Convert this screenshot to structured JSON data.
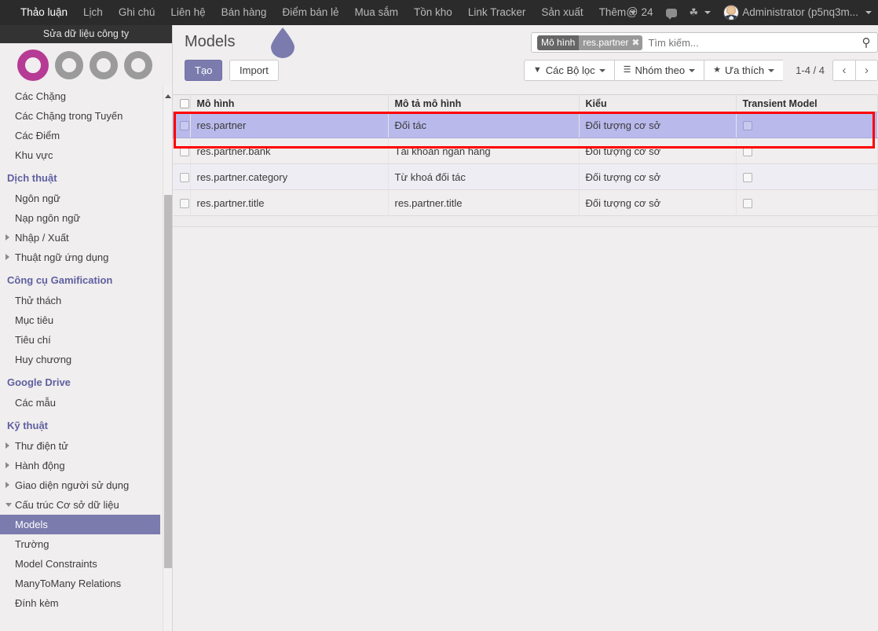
{
  "topbar": {
    "menu_items": [
      {
        "label": "Thảo luận",
        "name": "nav-discuss"
      },
      {
        "label": "Lịch",
        "name": "nav-calendar"
      },
      {
        "label": "Ghi chú",
        "name": "nav-notes"
      },
      {
        "label": "Liên hệ",
        "name": "nav-contacts"
      },
      {
        "label": "Bán hàng",
        "name": "nav-sales"
      },
      {
        "label": "Điểm bán lẻ",
        "name": "nav-pos"
      },
      {
        "label": "Mua sắm",
        "name": "nav-purchase"
      },
      {
        "label": "Tồn kho",
        "name": "nav-inventory"
      },
      {
        "label": "Link Tracker",
        "name": "nav-link-tracker"
      },
      {
        "label": "Sản xuất",
        "name": "nav-manufacturing"
      },
      {
        "label": "Thêm",
        "name": "nav-more",
        "has_caret": true
      }
    ],
    "mention_count": "24",
    "mention_icon": "at-icon",
    "messages_icon": "chat-bubble-icon",
    "debug_icon": "bug-icon",
    "user_name": "Administrator (p5nq3m...",
    "avatar_icon": "user-avatar"
  },
  "sidebar": {
    "company_bar_label": "Sửa dữ liệu công ty",
    "progress_rings": [
      {
        "state": "active",
        "color": "#b63b94"
      },
      {
        "state": "idle",
        "color": "#9b9b9b"
      },
      {
        "state": "idle",
        "color": "#9b9b9b"
      },
      {
        "state": "idle",
        "color": "#9b9b9b"
      }
    ],
    "items": [
      {
        "label": "Các Chặng",
        "type": "item",
        "name": "sidebar-item-cac-chang"
      },
      {
        "label": "Các Chặng trong Tuyến",
        "type": "item",
        "name": "sidebar-item-cac-chang-trong-tuyen"
      },
      {
        "label": "Các Điểm",
        "type": "item",
        "name": "sidebar-item-cac-diem"
      },
      {
        "label": "Khu vực",
        "type": "item",
        "name": "sidebar-item-khu-vuc"
      },
      {
        "label": "Dịch thuật",
        "type": "section",
        "name": "sidebar-section-dich-thuat"
      },
      {
        "label": "Ngôn ngữ",
        "type": "item",
        "name": "sidebar-item-ngon-ngu"
      },
      {
        "label": "Nạp ngôn ngữ",
        "type": "item",
        "name": "sidebar-item-nap-ngon-ngu"
      },
      {
        "label": "Nhập / Xuất",
        "type": "toggle",
        "state": "closed",
        "name": "sidebar-toggle-nhap-xuat"
      },
      {
        "label": "Thuật ngữ ứng dụng",
        "type": "toggle",
        "state": "closed",
        "name": "sidebar-toggle-thuat-ngu-ung-dung"
      },
      {
        "label": "Công cụ Gamification",
        "type": "section",
        "name": "sidebar-section-gamification"
      },
      {
        "label": "Thử thách",
        "type": "item",
        "name": "sidebar-item-thu-thach"
      },
      {
        "label": "Mục tiêu",
        "type": "item",
        "name": "sidebar-item-muc-tieu"
      },
      {
        "label": "Tiêu chí",
        "type": "item",
        "name": "sidebar-item-tieu-chi"
      },
      {
        "label": "Huy chương",
        "type": "item",
        "name": "sidebar-item-huy-chuong"
      },
      {
        "label": "Google Drive",
        "type": "section",
        "name": "sidebar-section-google-drive"
      },
      {
        "label": "Các mẫu",
        "type": "item",
        "name": "sidebar-item-cac-mau"
      },
      {
        "label": "Kỹ thuật",
        "type": "section",
        "name": "sidebar-section-ky-thuat"
      },
      {
        "label": "Thư điện tử",
        "type": "toggle",
        "state": "closed",
        "name": "sidebar-toggle-thu-dien-tu"
      },
      {
        "label": "Hành động",
        "type": "toggle",
        "state": "closed",
        "name": "sidebar-toggle-hanh-dong"
      },
      {
        "label": "Giao diện người sử dụng",
        "type": "toggle",
        "state": "closed",
        "name": "sidebar-toggle-giao-dien"
      },
      {
        "label": "Cấu trúc Cơ sở dữ liệu",
        "type": "toggle",
        "state": "open",
        "name": "sidebar-toggle-cau-truc-csdl"
      },
      {
        "label": "Models",
        "type": "item",
        "selected": true,
        "name": "sidebar-item-models"
      },
      {
        "label": "Trường",
        "type": "item",
        "name": "sidebar-item-truong"
      },
      {
        "label": "Model Constraints",
        "type": "item",
        "name": "sidebar-item-model-constraints"
      },
      {
        "label": "ManyToMany Relations",
        "type": "item",
        "name": "sidebar-item-manytomany-relations"
      },
      {
        "label": "Đính kèm",
        "type": "item",
        "name": "sidebar-item-dinh-kem"
      }
    ]
  },
  "control_panel": {
    "title": "Models",
    "create_label": "Tạo",
    "import_label": "Import",
    "marker_icon": "teardrop-marker-icon",
    "search": {
      "facet_key": "Mô hình",
      "facet_value": "res.partner",
      "facet_remove_icon": "close-icon",
      "placeholder": "Tìm kiếm...",
      "value": "",
      "search_icon": "search-icon"
    },
    "filters_label": "Các Bộ lọc",
    "filters_icon": "funnel-icon",
    "groupby_label": "Nhóm theo",
    "groupby_icon": "list-icon",
    "favorites_label": "Ưa thích",
    "favorites_icon": "star-icon",
    "pager_label": "1-4 / 4",
    "prev_icon": "chevron-left-icon",
    "next_icon": "chevron-right-icon"
  },
  "table": {
    "columns": [
      "Mô hình",
      "Mô tả mô hình",
      "Kiểu",
      "Transient Model"
    ],
    "rows": [
      {
        "model": "res.partner",
        "description": "Đối tác",
        "kind": "Đối tượng cơ sở",
        "transient": false,
        "selected": true
      },
      {
        "model": "res.partner.bank",
        "description": "Tài khoản ngân hàng",
        "kind": "Đối tượng cơ sở",
        "transient": false,
        "selected": false
      },
      {
        "model": "res.partner.category",
        "description": "Từ khoá đối tác",
        "kind": "Đối tượng cơ sở",
        "transient": false,
        "selected": false
      },
      {
        "model": "res.partner.title",
        "description": "res.partner.title",
        "kind": "Đối tượng cơ sở",
        "transient": false,
        "selected": false
      }
    ]
  },
  "annotation": {
    "highlight_color": "#ff0000",
    "highlight_target": "res.partner row"
  },
  "colors": {
    "accent_purple": "#7b7bae",
    "selected_row": "#b9b9ec",
    "section_heading": "#5f5fa0",
    "ring_active": "#b63b94",
    "navbar": "#2b2b2b"
  }
}
